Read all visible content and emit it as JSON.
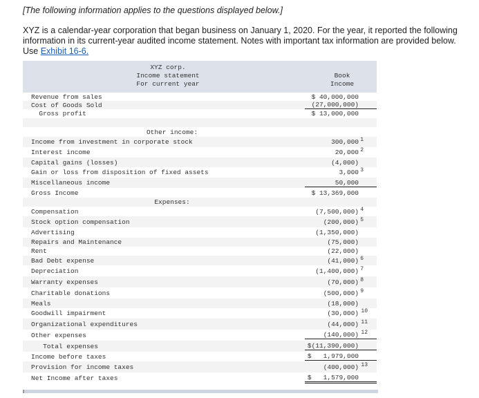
{
  "intro": {
    "note": "[The following information applies to the questions displayed below.]",
    "text": "XYZ is a calendar-year corporation that began business on January 1, 2020. For the year, it reported the following information in its current-year audited income statement. Notes with important tax information are provided below. Use ",
    "link": "Exhibit 16-6."
  },
  "table": {
    "title": [
      "XYZ corp.",
      "Income statement",
      "For current year"
    ],
    "column": [
      "Book",
      "Income"
    ],
    "rows": [
      {
        "label": "Revenue from sales",
        "value": "$ 40,000,000"
      },
      {
        "label": "Cost of Goods Sold",
        "value": "(27,000,000)"
      },
      {
        "label": "  Gross profit",
        "value": "$ 13,000,000"
      },
      {
        "label": "",
        "value": ""
      },
      {
        "section": "Other income:"
      },
      {
        "label": "Income from investment in corporate stock",
        "value": "300,000",
        "note": "1"
      },
      {
        "label": "Interest income",
        "value": "20,000",
        "note": "2"
      },
      {
        "label": "Capital gains (losses)",
        "value": "(4,000)"
      },
      {
        "label": "Gain or loss from disposition of fixed assets",
        "value": "3,000",
        "note": "3"
      },
      {
        "label": "Miscellaneous income",
        "value": "50,000"
      },
      {
        "label": "Gross Income",
        "value": "$ 13,369,000"
      },
      {
        "section": "Expenses:"
      },
      {
        "label": "Compensation",
        "value": "(7,500,000)",
        "note": "4"
      },
      {
        "label": "Stock option compensation",
        "value": "(200,000)",
        "note": "5"
      },
      {
        "label": "Advertising",
        "value": "(1,350,000)"
      },
      {
        "label": "Repairs and Maintenance",
        "value": "(75,000)"
      },
      {
        "label": "Rent",
        "value": "(22,000)"
      },
      {
        "label": "Bad Debt expense",
        "value": "(41,000)",
        "note": "6"
      },
      {
        "label": "Depreciation",
        "value": "(1,400,000)",
        "note": "7"
      },
      {
        "label": "Warranty expenses",
        "value": "(70,000)",
        "note": "8"
      },
      {
        "label": "Charitable donations",
        "value": "(500,000)",
        "note": "9"
      },
      {
        "label": "Meals",
        "value": "(18,000)"
      },
      {
        "label": "Goodwill impairment",
        "value": "(30,000)",
        "note": "10"
      },
      {
        "label": "Organizational expenditures",
        "value": "(44,000)",
        "note": "11"
      },
      {
        "label": "Other expenses",
        "value": "(140,000)",
        "note": "12"
      },
      {
        "label": "   Total expenses",
        "value": "$(11,390,000)"
      },
      {
        "label": "Income before taxes",
        "value": "$   1,979,000"
      },
      {
        "label": "Provision for income taxes",
        "value": "(400,000)",
        "note": "13"
      },
      {
        "label": "Net Income after taxes",
        "value": "$   1,579,000"
      }
    ]
  }
}
